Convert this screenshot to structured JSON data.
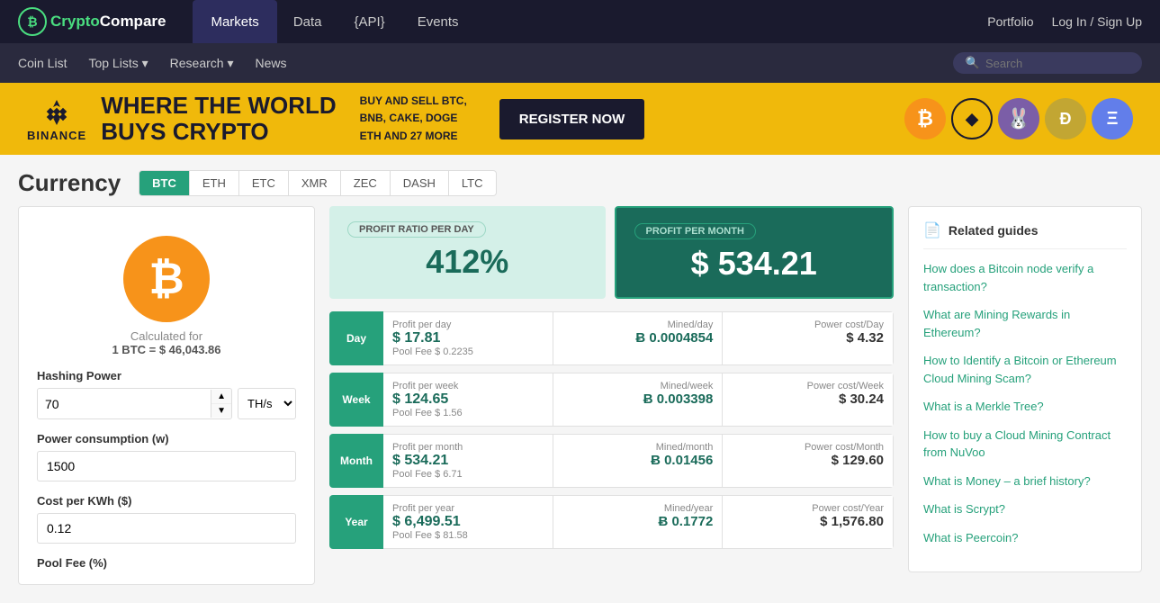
{
  "site": {
    "name_crypto": "Crypto",
    "name_compare": "Compare",
    "logo_symbol": "₿"
  },
  "top_nav": {
    "markets_label": "Markets",
    "data_label": "Data",
    "api_label": "{API}",
    "events_label": "Events",
    "portfolio_label": "Portfolio",
    "login_label": "Log In / Sign Up"
  },
  "sec_nav": {
    "coin_list": "Coin List",
    "top_lists": "Top Lists ▾",
    "research": "Research ▾",
    "news": "News",
    "search_placeholder": "Search"
  },
  "banner": {
    "brand": "BINANCE",
    "headline1": "WHERE THE WORLD",
    "headline2": "BUYS CRYPTO",
    "sub": "BUY AND SELL BTC,\nBNB, CAKE, DOGE\nETH AND 27 MORE",
    "cta": "REGISTER NOW"
  },
  "currency": {
    "title": "Currency",
    "tabs": [
      "BTC",
      "ETH",
      "ETC",
      "XMR",
      "ZEC",
      "DASH",
      "LTC"
    ],
    "active_tab": "BTC",
    "calc_label": "Calculated for",
    "calc_rate": "1 BTC = $ 46,043.86",
    "btc_symbol": "₿"
  },
  "form": {
    "hashing_power_label": "Hashing Power",
    "hashing_power_value": "70",
    "hashing_power_unit": "TH/s",
    "power_consumption_label": "Power consumption (w)",
    "power_consumption_value": "1500",
    "cost_per_kwh_label": "Cost per KWh ($)",
    "cost_per_kwh_value": "0.12",
    "pool_fee_label": "Pool Fee (%)"
  },
  "profit_day": {
    "label": "PROFIT RATIO PER DAY",
    "value": "412%"
  },
  "profit_month": {
    "label": "PROFIT PER MONTH",
    "value": "$ 534.21"
  },
  "periods": [
    {
      "name": "Day",
      "profit_label": "Profit per day",
      "profit_value": "$ 17.81",
      "pool_fee": "Pool Fee $ 0.2235",
      "mined_label": "Mined/day",
      "mined_value": "Ƀ 0.0004854",
      "power_label": "Power cost/Day",
      "power_value": "$ 4.32"
    },
    {
      "name": "Week",
      "profit_label": "Profit per week",
      "profit_value": "$ 124.65",
      "pool_fee": "Pool Fee $ 1.56",
      "mined_label": "Mined/week",
      "mined_value": "Ƀ 0.003398",
      "power_label": "Power cost/Week",
      "power_value": "$ 30.24"
    },
    {
      "name": "Month",
      "profit_label": "Profit per month",
      "profit_value": "$ 534.21",
      "pool_fee": "Pool Fee $ 6.71",
      "mined_label": "Mined/month",
      "mined_value": "Ƀ 0.01456",
      "power_label": "Power cost/Month",
      "power_value": "$ 129.60"
    },
    {
      "name": "Year",
      "profit_label": "Profit per year",
      "profit_value": "$ 6,499.51",
      "pool_fee": "Pool Fee $ 81.58",
      "mined_label": "Mined/year",
      "mined_value": "Ƀ 0.1772",
      "power_label": "Power cost/Year",
      "power_value": "$ 1,576.80"
    }
  ],
  "related_guides": {
    "title": "Related guides",
    "items": [
      {
        "text": "How does a Bitcoin node verify a transaction?",
        "link": true
      },
      {
        "text": "What are Mining Rewards in Ethereum?",
        "link": true
      },
      {
        "text": "How to Identify a Bitcoin or Ethereum Cloud Mining Scam?",
        "link": true
      },
      {
        "text": "What is a Merkle Tree?",
        "link": true
      },
      {
        "text": "How to buy a Cloud Mining Contract from NuVoo",
        "link": true
      },
      {
        "text": "What is Money – a brief history?",
        "link": true
      },
      {
        "text": "What is Scrypt?",
        "link": true
      },
      {
        "text": "What is Peercoin?",
        "link": true
      }
    ]
  }
}
